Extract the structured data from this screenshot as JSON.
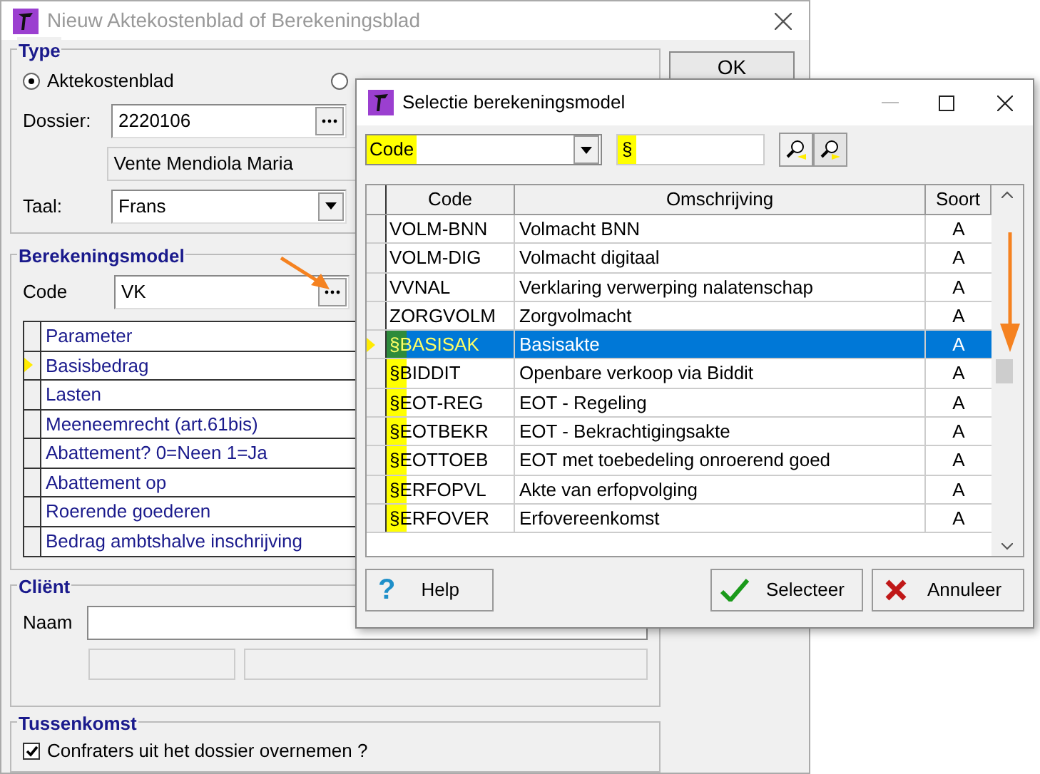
{
  "back_window": {
    "title": "Nieuw Aktekostenblad of Berekeningsblad",
    "ok_button": "OK",
    "type_group": {
      "legend": "Type",
      "radios": [
        {
          "label": "Aktekostenblad",
          "selected": true
        },
        {
          "selected": false
        }
      ]
    },
    "dossier": {
      "label": "Dossier:",
      "value": "2220106",
      "name": "Vente Mendiola Maria"
    },
    "taal": {
      "label": "Taal:",
      "value": "Frans"
    },
    "model_group": {
      "legend": "Berekeningsmodel",
      "code_label": "Code",
      "code_value": "VK",
      "parameters": [
        {
          "label": "Parameter",
          "current": false
        },
        {
          "label": "Basisbedrag",
          "current": true
        },
        {
          "label": "Lasten",
          "current": false
        },
        {
          "label": "Meeneemrecht (art.61bis)",
          "current": false
        },
        {
          "label": "Abattement? 0=Neen 1=Ja",
          "current": false
        },
        {
          "label": "Abattement op",
          "current": false
        },
        {
          "label": "Roerende goederen",
          "current": false
        },
        {
          "label": "Bedrag ambtshalve inschrijving",
          "current": false
        }
      ]
    },
    "client_group": {
      "legend": "Cliënt",
      "naam_label": "Naam"
    },
    "tussenkomst_group": {
      "legend": "Tussenkomst",
      "checkbox": {
        "label": "Confraters uit het dossier overnemen ?",
        "checked": true
      }
    }
  },
  "dialog": {
    "title": "Selectie berekeningsmodel",
    "search_field": "Code",
    "search_value": "§",
    "columns": [
      "Code",
      "Omschrijving",
      "Soort"
    ],
    "rows": [
      {
        "code": "VOLM-BNN",
        "description": "Volmacht BNN",
        "soort": "A",
        "selected": false,
        "highlighted": false
      },
      {
        "code": "VOLM-DIG",
        "description": "Volmacht digitaal",
        "soort": "A",
        "selected": false,
        "highlighted": false
      },
      {
        "code": "VVNAL",
        "description": "Verklaring verwerping nalatenschap",
        "soort": "A",
        "selected": false,
        "highlighted": false
      },
      {
        "code": "ZORGVOLM",
        "description": "Zorgvolmacht",
        "soort": "A",
        "selected": false,
        "highlighted": false
      },
      {
        "code": "§BASISAK",
        "description": "Basisakte",
        "soort": "A",
        "selected": true,
        "highlighted": true
      },
      {
        "code": "§BIDDIT",
        "description": "Openbare verkoop via Biddit",
        "soort": "A",
        "selected": false,
        "highlighted": true
      },
      {
        "code": "§EOT-REG",
        "description": "EOT - Regeling",
        "soort": "A",
        "selected": false,
        "highlighted": true
      },
      {
        "code": "§EOTBEKR",
        "description": "EOT - Bekrachtigingsakte",
        "soort": "A",
        "selected": false,
        "highlighted": true
      },
      {
        "code": "§EOTTOEB",
        "description": "EOT  met toebedeling onroerend goed",
        "soort": "A",
        "selected": false,
        "highlighted": true
      },
      {
        "code": "§ERFOPVL",
        "description": "Akte van erfopvolging",
        "soort": "A",
        "selected": false,
        "highlighted": true
      },
      {
        "code": "§ERFOVER",
        "description": "Erfovereenkomst",
        "soort": "A",
        "selected": false,
        "highlighted": true
      }
    ],
    "buttons": {
      "help_icon": "?",
      "help": "Help",
      "select": "Selecteer",
      "cancel": "Annuleer"
    }
  }
}
